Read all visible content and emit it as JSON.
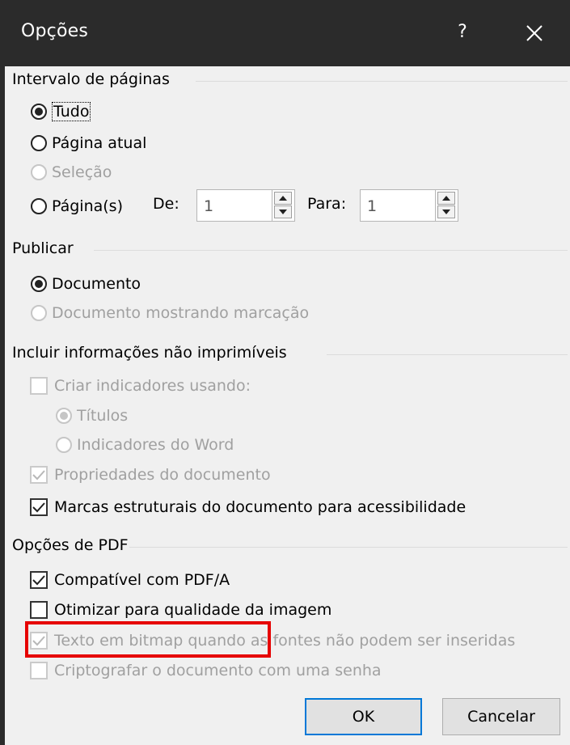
{
  "window": {
    "title": "Opções",
    "help_label": "?",
    "close_icon": "close-icon"
  },
  "page_range": {
    "title": "Intervalo de páginas",
    "options": [
      {
        "label": "Tudo",
        "selected": true,
        "enabled": true
      },
      {
        "label": "Página atual",
        "selected": false,
        "enabled": true
      },
      {
        "label": "Seleção",
        "selected": false,
        "enabled": false
      },
      {
        "label": "Página(s)",
        "selected": false,
        "enabled": true
      }
    ],
    "from_label": "De:",
    "from_value": "1",
    "to_label": "Para:",
    "to_value": "1"
  },
  "publish": {
    "title": "Publicar",
    "options": [
      {
        "label": "Documento",
        "selected": true,
        "enabled": true
      },
      {
        "label": "Documento mostrando marcação",
        "selected": false,
        "enabled": false
      }
    ]
  },
  "non_printable": {
    "title": "Incluir informações não imprimíveis",
    "create_bookmarks": {
      "label": "Criar indicadores usando:",
      "checked": false,
      "enabled": false
    },
    "bookmark_options": [
      {
        "label": "Títulos",
        "selected": true,
        "enabled": false
      },
      {
        "label": "Indicadores do Word",
        "selected": false,
        "enabled": false
      }
    ],
    "doc_properties": {
      "label": "Propriedades do documento",
      "checked": true,
      "enabled": false
    },
    "structure_tags": {
      "label": "Marcas estruturais do documento para acessibilidade",
      "checked": true,
      "enabled": true
    }
  },
  "pdf_options": {
    "title": "Opções de PDF",
    "pdfa": {
      "label": "Compatível com PDF/A",
      "checked": true,
      "enabled": true
    },
    "optimize_image": {
      "label": "Otimizar para qualidade da imagem",
      "checked": false,
      "enabled": true
    },
    "bitmap_text": {
      "label": "Texto em bitmap quando as fontes não podem ser inseridas",
      "checked": true,
      "enabled": false
    },
    "encrypt": {
      "label": "Criptografar o documento com uma senha",
      "checked": false,
      "enabled": false
    }
  },
  "buttons": {
    "ok": "OK",
    "cancel": "Cancelar"
  },
  "colors": {
    "titlebar": "#2b2b2b",
    "highlight": "#e60000",
    "default_button_border": "#0078d7"
  }
}
